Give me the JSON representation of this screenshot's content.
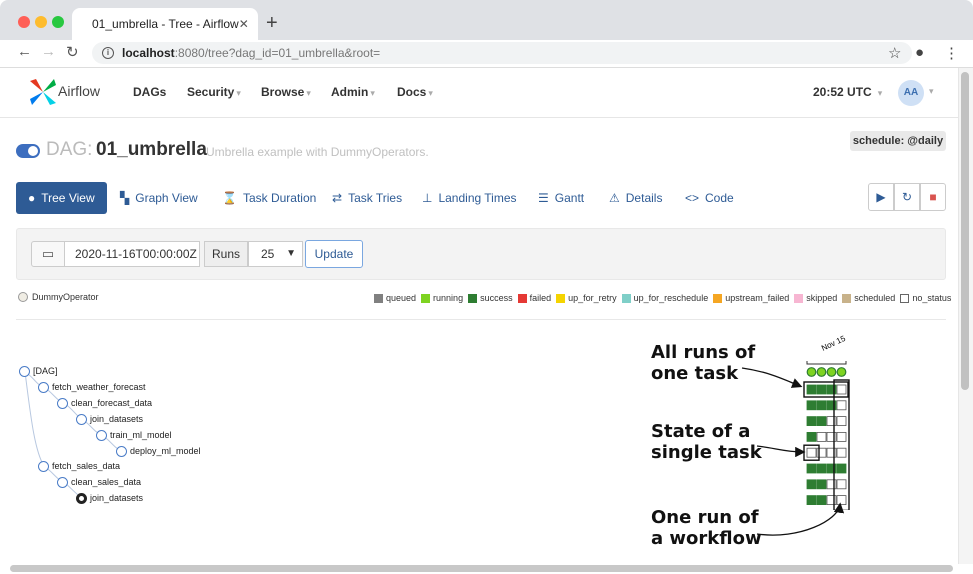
{
  "browser": {
    "tab_title": "01_umbrella - Tree - Airflow",
    "tab_close": "✕",
    "new_tab": "+",
    "url_host": "localhost",
    "url_rest": ":8080/tree?dag_id=01_umbrella&root="
  },
  "navbar": {
    "brand": "Airflow",
    "menus": [
      "DAGs",
      "Security",
      "Browse",
      "Admin",
      "Docs"
    ],
    "clock": "20:52 UTC",
    "avatar": "AA"
  },
  "dag": {
    "label": "DAG:",
    "id": "01_umbrella",
    "description": "Umbrella example with DummyOperators.",
    "schedule": "schedule: @daily"
  },
  "view_tabs": [
    {
      "label": "Tree View",
      "icon": "tree-icon"
    },
    {
      "label": "Graph View",
      "icon": "graph-icon"
    },
    {
      "label": "Task Duration",
      "icon": "hourglass-icon"
    },
    {
      "label": "Task Tries",
      "icon": "retry-icon"
    },
    {
      "label": "Landing Times",
      "icon": "landing-icon"
    },
    {
      "label": "Gantt",
      "icon": "gantt-icon"
    },
    {
      "label": "Details",
      "icon": "warning-icon"
    },
    {
      "label": "Code",
      "icon": "code-icon"
    }
  ],
  "filter": {
    "base_date": "2020-11-16T00:00:00Z",
    "runs_label": "Runs",
    "runs_value": "25",
    "update_label": "Update"
  },
  "operator_legend": "DummyOperator",
  "state_legend": [
    {
      "label": "queued",
      "color": "#808080"
    },
    {
      "label": "running",
      "color": "#7ed321"
    },
    {
      "label": "success",
      "color": "#2e7d32"
    },
    {
      "label": "failed",
      "color": "#e53935"
    },
    {
      "label": "up_for_retry",
      "color": "#f5d400"
    },
    {
      "label": "up_for_reschedule",
      "color": "#7fcfc8"
    },
    {
      "label": "upstream_failed",
      "color": "#f5a623"
    },
    {
      "label": "skipped",
      "color": "#f7b6d2"
    },
    {
      "label": "scheduled",
      "color": "#c8b28a"
    },
    {
      "label": "no_status",
      "color": "#ffffff"
    }
  ],
  "tree_nodes": [
    "[DAG]",
    "fetch_weather_forecast",
    "clean_forecast_data",
    "join_datasets",
    "train_ml_model",
    "deploy_ml_model",
    "fetch_sales_data",
    "clean_sales_data",
    "join_datasets"
  ],
  "grid": {
    "date_label": "Nov 15",
    "rows": [
      [
        "success",
        "success",
        "success",
        "no_status"
      ],
      [
        "success",
        "success",
        "success",
        "no_status"
      ],
      [
        "success",
        "success",
        "no_status",
        "no_status"
      ],
      [
        "success",
        "no_status",
        "no_status",
        "no_status"
      ],
      [
        "no_status",
        "no_status",
        "no_status",
        "no_status"
      ],
      [
        "success",
        "success",
        "success",
        "success"
      ],
      [
        "success",
        "success",
        "no_status",
        "no_status"
      ],
      [
        "success",
        "success",
        "no_status",
        "no_status"
      ]
    ]
  },
  "annotations": {
    "all_runs": [
      "All runs of",
      "one task"
    ],
    "state_single": [
      "State of a",
      "single task"
    ],
    "one_run": [
      "One run of",
      "a workflow"
    ]
  }
}
